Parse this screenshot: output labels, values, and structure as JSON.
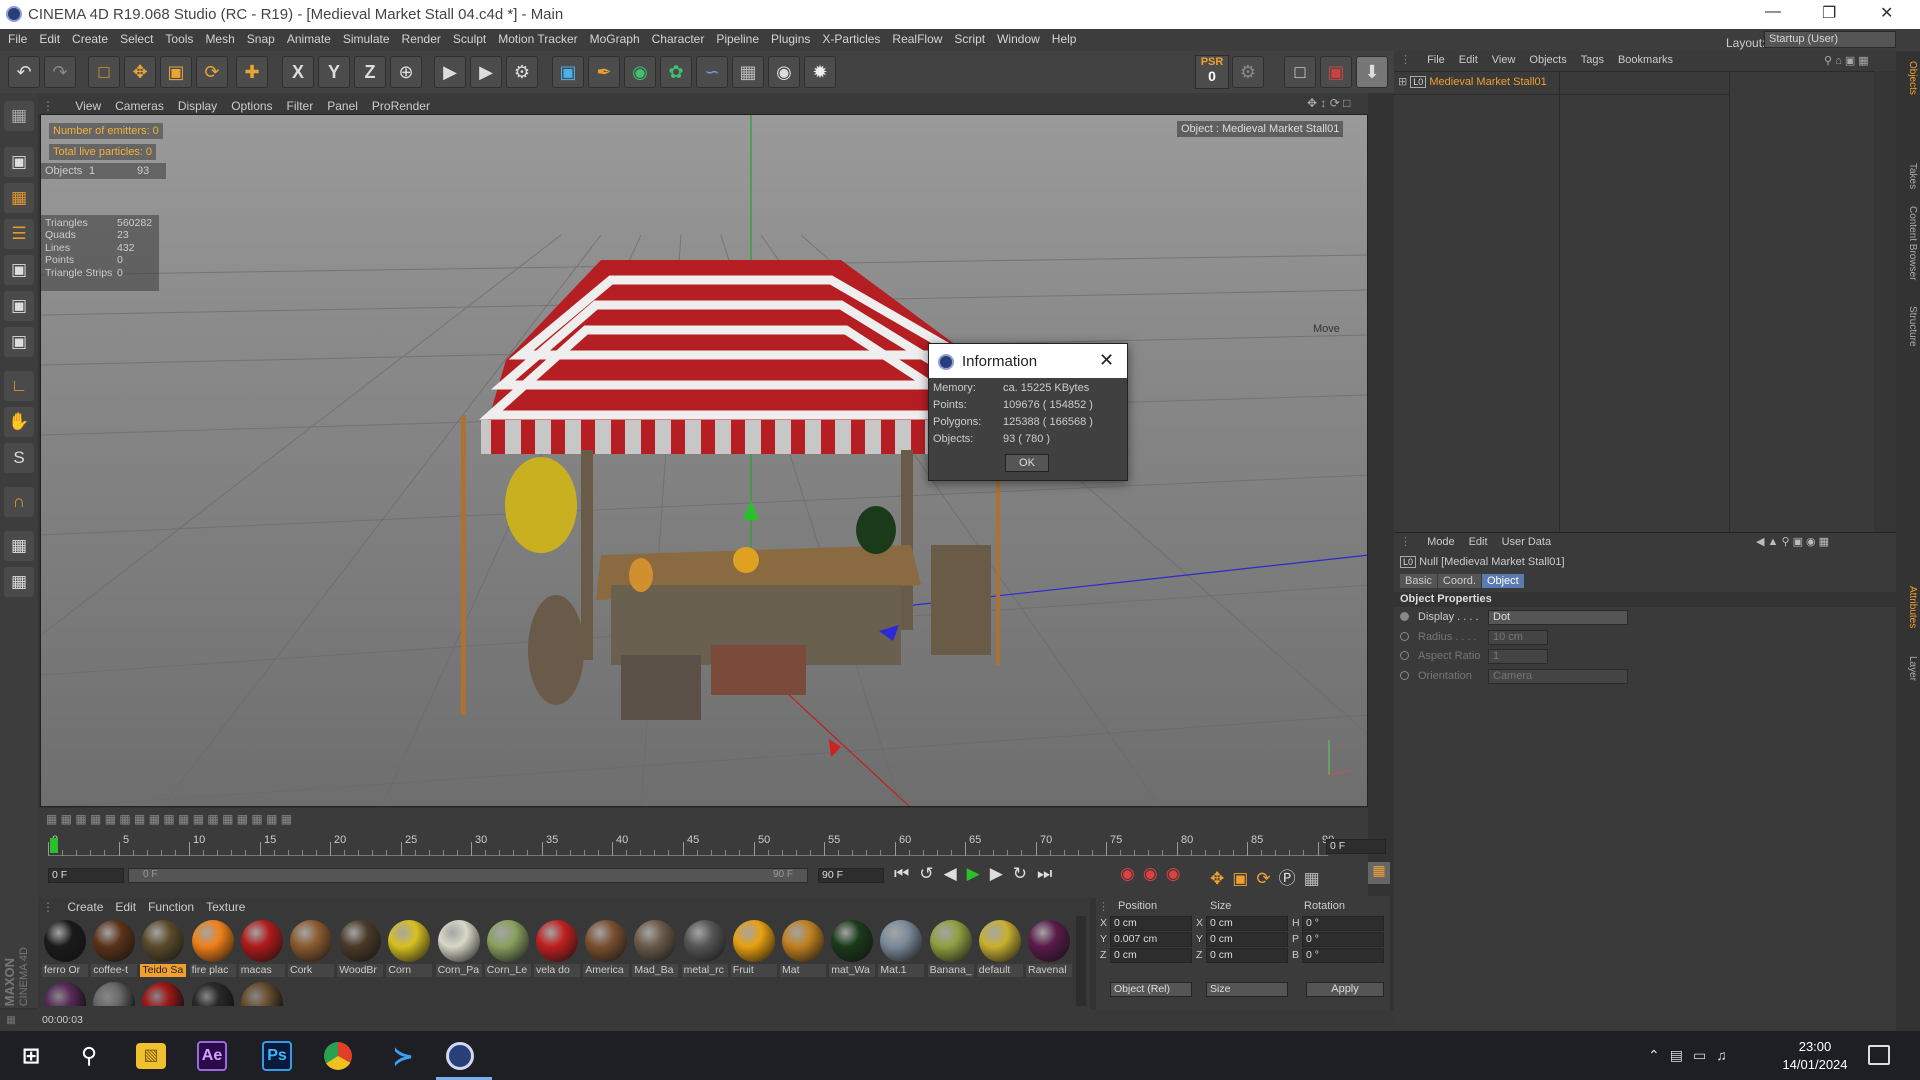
{
  "window": {
    "title": "CINEMA 4D R19.068 Studio (RC - R19) - [Medieval Market Stall 04.c4d *] - Main",
    "layout_label": "Layout:",
    "layout_value": "Startup (User)"
  },
  "menu": [
    "File",
    "Edit",
    "Create",
    "Select",
    "Tools",
    "Mesh",
    "Snap",
    "Animate",
    "Simulate",
    "Render",
    "Sculpt",
    "Motion Tracker",
    "MoGraph",
    "Character",
    "Pipeline",
    "Plugins",
    "X-Particles",
    "RealFlow",
    "Script",
    "Window",
    "Help"
  ],
  "toolbar": {
    "psr_label": "PSR",
    "psr_value": "0"
  },
  "viewport_menu": [
    "View",
    "Cameras",
    "Display",
    "Options",
    "Filter",
    "Panel",
    "ProRender"
  ],
  "hud": {
    "emitters": "Number of emitters: 0",
    "particles": "Total live particles: 0",
    "objects_label": "Objects",
    "objects_a": "1",
    "objects_b": "93",
    "stats": [
      {
        "k": "Triangles",
        "v": "560282"
      },
      {
        "k": "Quads",
        "v": "23"
      },
      {
        "k": "Lines",
        "v": "432"
      },
      {
        "k": "Points",
        "v": "0"
      },
      {
        "k": "Triangle Strips",
        "v": "0"
      }
    ],
    "object_tag": "Object : Medieval Market Stall01",
    "move": "Move"
  },
  "dialog": {
    "title": "Information",
    "rows": [
      {
        "k": "Memory:",
        "v": "ca. 15225 KBytes"
      },
      {
        "k": "Points:",
        "v": "109676 ( 154852 )"
      },
      {
        "k": "Polygons:",
        "v": "125388 ( 166568 )"
      },
      {
        "k": "Objects:",
        "v": "93 ( 780 )"
      }
    ],
    "ok": "OK"
  },
  "timeline": {
    "ticks": [
      "0",
      "5",
      "10",
      "15",
      "20",
      "25",
      "30",
      "35",
      "40",
      "45",
      "50",
      "55",
      "60",
      "65",
      "70",
      "75",
      "80",
      "85",
      "90"
    ],
    "current_frame": "0 F",
    "start": "0 F",
    "range_start": "0 F",
    "range_end": "90 F",
    "end": "90 F",
    "right_frame": "0 F"
  },
  "materials": {
    "menu": [
      "Create",
      "Edit",
      "Function",
      "Texture"
    ],
    "items": [
      {
        "name": "ferro Or",
        "color": "#1a1a1a"
      },
      {
        "name": "coffee-t",
        "color": "#5a3218"
      },
      {
        "name": "Teido Sa",
        "color": "#5a4a2a"
      },
      {
        "name": "fire plac",
        "color": "#f08018"
      },
      {
        "name": "macas",
        "color": "#b01a1a"
      },
      {
        "name": "Cork",
        "color": "#8a5a30"
      },
      {
        "name": "WoodBr",
        "color": "#4a3a28"
      },
      {
        "name": "Corn",
        "color": "#d8c020"
      },
      {
        "name": "Corn_Pa",
        "color": "#d8d8c8"
      },
      {
        "name": "Corn_Le",
        "color": "#8aa060"
      },
      {
        "name": "vela do",
        "color": "#c02020"
      },
      {
        "name": "America",
        "color": "#7a5030"
      },
      {
        "name": "Mad_Ba",
        "color": "#6a5a4a"
      },
      {
        "name": "metal_rc",
        "color": "#555555"
      },
      {
        "name": "Fruit",
        "color": "#e8a010"
      },
      {
        "name": "Mat",
        "color": "#c08020"
      },
      {
        "name": "mat_Wa",
        "color": "#1a3a1a"
      },
      {
        "name": "Mat.1",
        "color": "#7a8a9a"
      },
      {
        "name": "Banana_",
        "color": "#90a040"
      },
      {
        "name": "default",
        "color": "#c8b030"
      },
      {
        "name": "Ravenal",
        "color": "#5a1a4a"
      }
    ],
    "row2_colors": [
      "#5a2a5a",
      "#6a6a6a",
      "#a01818",
      "#2a2a2a",
      "#6a5030"
    ]
  },
  "coords": {
    "headers": [
      "Position",
      "Size",
      "Rotation"
    ],
    "rows": [
      {
        "axis": "X",
        "pos": "0 cm",
        "saxis": "X",
        "size": "0 cm",
        "raxis": "H",
        "rot": "0 °"
      },
      {
        "axis": "Y",
        "pos": "0.007 cm",
        "saxis": "Y",
        "size": "0 cm",
        "raxis": "P",
        "rot": "0 °"
      },
      {
        "axis": "Z",
        "pos": "0 cm",
        "saxis": "Z",
        "size": "0 cm",
        "raxis": "B",
        "rot": "0 °"
      }
    ],
    "mode1": "Object (Rel)",
    "mode2": "Size",
    "apply": "Apply"
  },
  "objects_panel": {
    "menu": [
      "File",
      "Edit",
      "View",
      "Objects",
      "Tags",
      "Bookmarks"
    ],
    "item": "Medieval Market Stall01"
  },
  "attributes": {
    "menu": [
      "Mode",
      "Edit",
      "User Data"
    ],
    "object": "Null [Medieval Market Stall01]",
    "tabs": [
      "Basic",
      "Coord.",
      "Object"
    ],
    "section": "Object Properties",
    "props": [
      {
        "k": "Display . . . .",
        "v": "Dot"
      },
      {
        "k": "Radius . . . .",
        "v": "10 cm"
      },
      {
        "k": "Aspect Ratio",
        "v": "1"
      },
      {
        "k": "Orientation",
        "v": "Camera"
      }
    ]
  },
  "right_tabs": [
    "Objects",
    "Takes",
    "Content Browser",
    "Structure",
    "Attributes",
    "Layer"
  ],
  "status": {
    "time": "00:00:03",
    "brand1": "MAXON",
    "brand2": "CINEMA 4D"
  },
  "taskbar": {
    "time": "23:00",
    "date": "14/01/2024",
    "apps": [
      "Ae",
      "Ps"
    ]
  }
}
